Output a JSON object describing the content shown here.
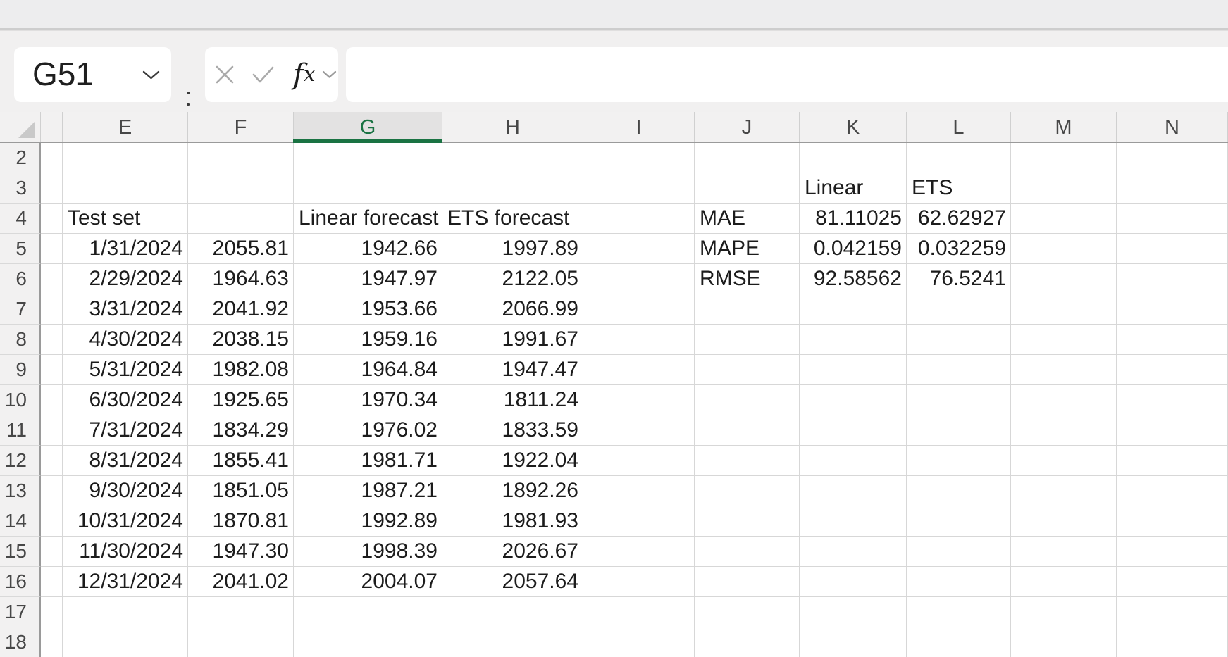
{
  "name_box": {
    "value": "G51"
  },
  "formula_bar": {
    "value": ""
  },
  "icons": {
    "name_box_chevron": "chevron-down",
    "more_options": "kebab-vertical-dots",
    "cancel": "x-cross",
    "enter": "checkmark",
    "insert_function": "fx",
    "formula_chevron": "chevron-down",
    "select_all": "corner-triangle"
  },
  "colors": {
    "selected_column_accent": "#1a7343",
    "selected_header_bg": "#e3e2e2",
    "header_bg": "#f2f1f1",
    "gridline": "#d7d7d7",
    "header_divider": "#9a9a9a",
    "chrome_bg": "#f1f0f0"
  },
  "spreadsheet": {
    "selected_cell": "G51",
    "selected_column": "G",
    "columns": [
      {
        "letter": ""
      },
      {
        "letter": "E"
      },
      {
        "letter": "F"
      },
      {
        "letter": "G"
      },
      {
        "letter": "H"
      },
      {
        "letter": "I"
      },
      {
        "letter": "J"
      },
      {
        "letter": "K"
      },
      {
        "letter": "L"
      },
      {
        "letter": "M"
      },
      {
        "letter": "N"
      }
    ],
    "row_numbers": [
      2,
      3,
      4,
      5,
      6,
      7,
      8,
      9,
      10,
      11,
      12,
      13,
      14,
      15,
      16,
      17,
      18
    ],
    "test_table": {
      "header_row": 4,
      "title": "Test set",
      "linear_header": "Linear forecast",
      "ets_header": "ETS forecast",
      "rows": [
        {
          "row": 5,
          "date": "1/31/2024",
          "actual": "2055.81",
          "linear": "1942.66",
          "ets": "1997.89"
        },
        {
          "row": 6,
          "date": "2/29/2024",
          "actual": "1964.63",
          "linear": "1947.97",
          "ets": "2122.05"
        },
        {
          "row": 7,
          "date": "3/31/2024",
          "actual": "2041.92",
          "linear": "1953.66",
          "ets": "2066.99"
        },
        {
          "row": 8,
          "date": "4/30/2024",
          "actual": "2038.15",
          "linear": "1959.16",
          "ets": "1991.67"
        },
        {
          "row": 9,
          "date": "5/31/2024",
          "actual": "1982.08",
          "linear": "1964.84",
          "ets": "1947.47"
        },
        {
          "row": 10,
          "date": "6/30/2024",
          "actual": "1925.65",
          "linear": "1970.34",
          "ets": "1811.24"
        },
        {
          "row": 11,
          "date": "7/31/2024",
          "actual": "1834.29",
          "linear": "1976.02",
          "ets": "1833.59"
        },
        {
          "row": 12,
          "date": "8/31/2024",
          "actual": "1855.41",
          "linear": "1981.71",
          "ets": "1922.04"
        },
        {
          "row": 13,
          "date": "9/30/2024",
          "actual": "1851.05",
          "linear": "1987.21",
          "ets": "1892.26"
        },
        {
          "row": 14,
          "date": "10/31/2024",
          "actual": "1870.81",
          "linear": "1992.89",
          "ets": "1981.93"
        },
        {
          "row": 15,
          "date": "11/30/2024",
          "actual": "1947.30",
          "linear": "1998.39",
          "ets": "2026.67"
        },
        {
          "row": 16,
          "date": "12/31/2024",
          "actual": "2041.02",
          "linear": "2004.07",
          "ets": "2057.64"
        }
      ]
    },
    "metrics": {
      "header_row": 3,
      "linear_label": "Linear",
      "ets_label": "ETS",
      "rows": [
        {
          "row": 4,
          "label": "MAE",
          "linear": "81.11025",
          "ets": "62.62927"
        },
        {
          "row": 5,
          "label": "MAPE",
          "linear": "0.042159",
          "ets": "0.032259"
        },
        {
          "row": 6,
          "label": "RMSE",
          "linear": "92.58562",
          "ets": "76.5241"
        }
      ]
    }
  }
}
